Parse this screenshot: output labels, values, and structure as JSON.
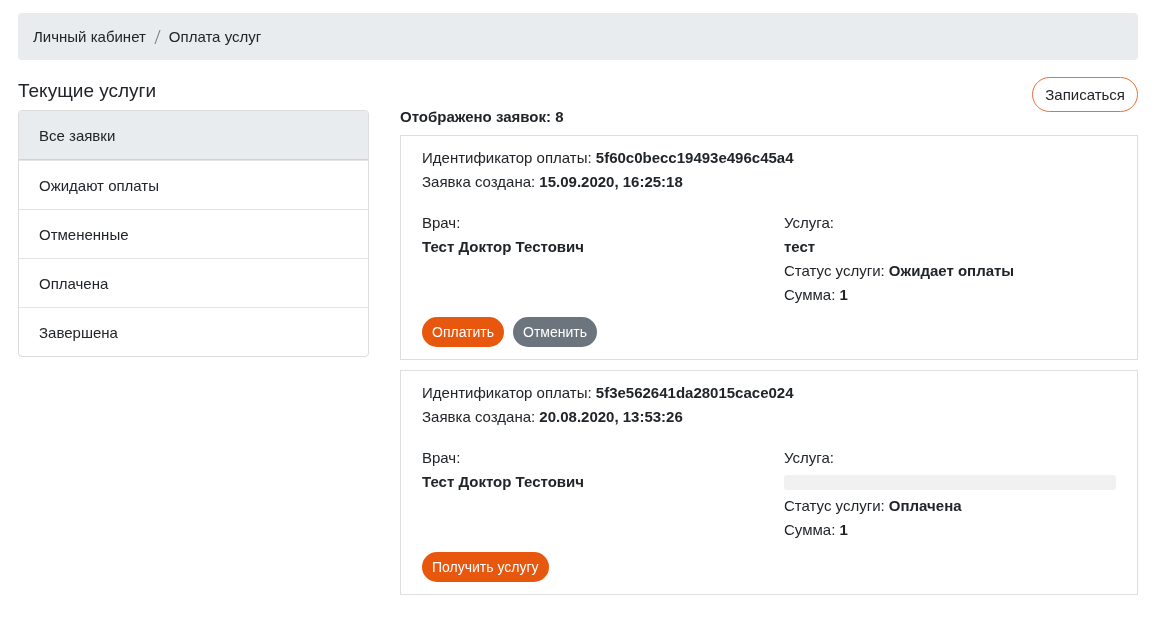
{
  "breadcrumb": [
    {
      "label": "Личный кабинет"
    },
    {
      "label": "Оплата услуг"
    }
  ],
  "heading": "Текущие услуги",
  "signup_button": "Записаться",
  "filters": [
    {
      "label": "Все заявки",
      "selected": true
    },
    {
      "label": "Ожидают оплаты",
      "selected": false
    },
    {
      "label": "Отмененные",
      "selected": false
    },
    {
      "label": "Оплачена",
      "selected": false
    },
    {
      "label": "Завершена",
      "selected": false
    }
  ],
  "count_text": "Отображено заявок: 8",
  "orders": [
    {
      "id_label": "Идентификатор оплаты:",
      "id": "5f60c0becc19493e496c45a4",
      "created_label": "Заявка создана:",
      "created": "15.09.2020, 16:25:18",
      "doctor_label": "Врач:",
      "doctor": "Тест Доктор Тестович",
      "service_label": "Услуга:",
      "service": "тест",
      "service_loading": false,
      "status_label": "Статус услуги:",
      "status": "Ожидает оплаты",
      "sum_label": "Сумма:",
      "sum": "1",
      "buttons": [
        {
          "label": "Оплатить",
          "kind": "primary"
        },
        {
          "label": "Отменить",
          "kind": "secondary"
        }
      ]
    },
    {
      "id_label": "Идентификатор оплаты:",
      "id": "5f3e562641da28015cace024",
      "created_label": "Заявка создана:",
      "created": "20.08.2020, 13:53:26",
      "doctor_label": "Врач:",
      "doctor": "Тест Доктор Тестович",
      "service_label": "Услуга:",
      "service_loading": true,
      "status_label": "Статус услуги:",
      "status": "Оплачена",
      "sum_label": "Сумма:",
      "sum": "1",
      "buttons": [
        {
          "label": "Получить услугу",
          "kind": "primary"
        }
      ]
    }
  ]
}
